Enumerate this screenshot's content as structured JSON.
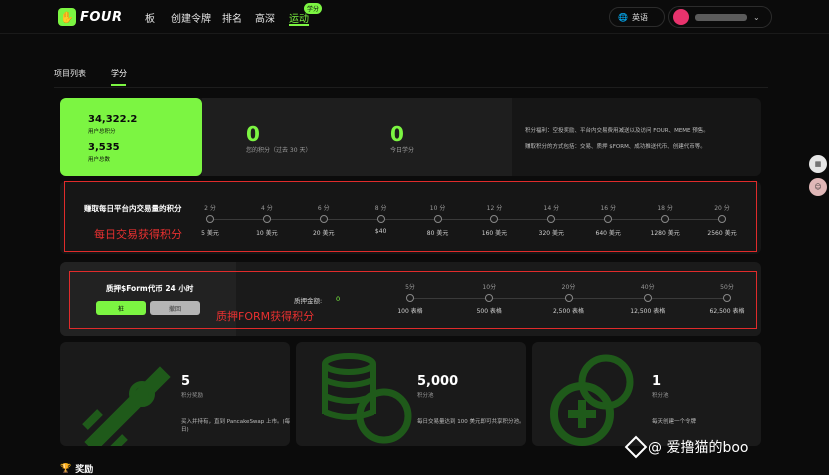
{
  "nav": {
    "logo": "FOUR",
    "items": [
      "板",
      "创建令牌",
      "排名",
      "高深",
      "运动"
    ],
    "badge": "学分",
    "language": "英语"
  },
  "tabs": [
    "项目列表",
    "学分"
  ],
  "summary": {
    "total_points_value": "34,322.2",
    "total_points_label": "用户总积分",
    "total_users_value": "3,535",
    "total_users_label": "用户总数",
    "your_points_value": "0",
    "your_points_label": "您的积分（过去 30 天）",
    "today_value": "0",
    "today_label": "今日学分",
    "info_line1": "积分福利：空投奖励、平台内交易费用减送以及访问 FOUR、MEME 预售。",
    "info_line2": "赚取积分的方式包括：交易、质押 $FORM、成功推送代币、创建代币等。"
  },
  "trade": {
    "title": "赚取每日平台内交易量的积分",
    "annotation": "每日交易获得积分",
    "points": [
      "2 分",
      "4 分",
      "6 分",
      "8 分",
      "10 分",
      "12 分",
      "14 分",
      "16 分",
      "18 分",
      "20 分"
    ],
    "amounts": [
      "5 美元",
      "10 美元",
      "20 美元",
      "$40",
      "80 美元",
      "160 美元",
      "320 美元",
      "640 美元",
      "1280 美元",
      "2560 美元"
    ]
  },
  "stake": {
    "title": "质押$Form代币 24 小时",
    "stake_button": "桩",
    "withdraw_button": "撤回",
    "amount_label": "质押金额:",
    "amount_value": "0",
    "annotation": "质押FORM获得积分",
    "points": [
      "5分",
      "10分",
      "20分",
      "40分",
      "50分"
    ],
    "amounts": [
      "100 表格",
      "500 表格",
      "2,500 表格",
      "12,500 表格",
      "62,500 表格"
    ]
  },
  "cards": [
    {
      "value": "5",
      "label": "积分奖励",
      "desc": "买入并持有，直到 PancakeSwap 上市。(每日)"
    },
    {
      "value": "5,000",
      "label": "积分池",
      "desc": "每日交易量达到 100 美元即可共享积分池。"
    },
    {
      "value": "1",
      "label": "积分池",
      "desc": "每天创建一个令牌"
    }
  ],
  "reward_title": "奖励",
  "watermark": "@ 爱撸猫的boo",
  "colors": {
    "accent": "#7cf542",
    "annotation_red": "#e02b2b"
  }
}
